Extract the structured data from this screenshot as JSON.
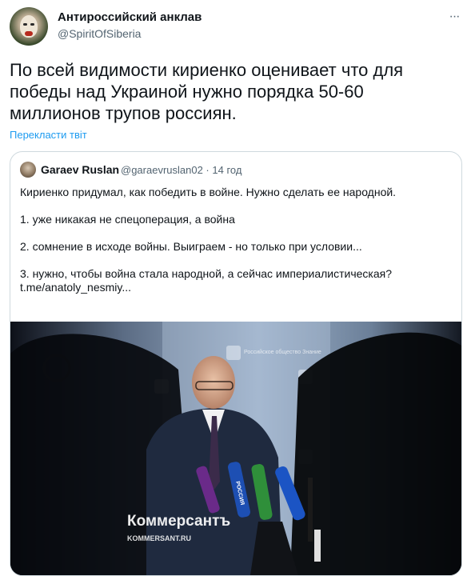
{
  "author": {
    "display_name": "Антироссийский анклав",
    "handle": "@SpiritOfSiberia"
  },
  "tweet": {
    "text": "По всей видимости кириенко оценивает что для победы над Украиной нужно порядка 50-60 миллионов трупов россиян.",
    "translate_label": "Перекласти твіт"
  },
  "quoted": {
    "display_name": "Garaev Ruslan",
    "meta": "@garaevruslan02 · 14 год",
    "lines": [
      "Кириенко придумал, как победить в войне. Нужно сделать ее народной.",
      "1. уже никакая не спецоперация, а война",
      "2. сомнение в исходе войны. Выиграем - но только при условии...",
      "3. нужно, чтобы война стала народной, а сейчас империалистическая?",
      "t.me/anatoly_nesmiy..."
    ],
    "image": {
      "watermark": "Коммерсантъ",
      "watermark_url": "KOMMERSANT.RU",
      "mic_label": "РОССИЯ",
      "backdrop_text": "Российское общество Знание"
    }
  },
  "icons": {
    "more": "more-dots-icon",
    "avatar": "avatar-image",
    "quoted_avatar": "quoted-avatar-image"
  }
}
